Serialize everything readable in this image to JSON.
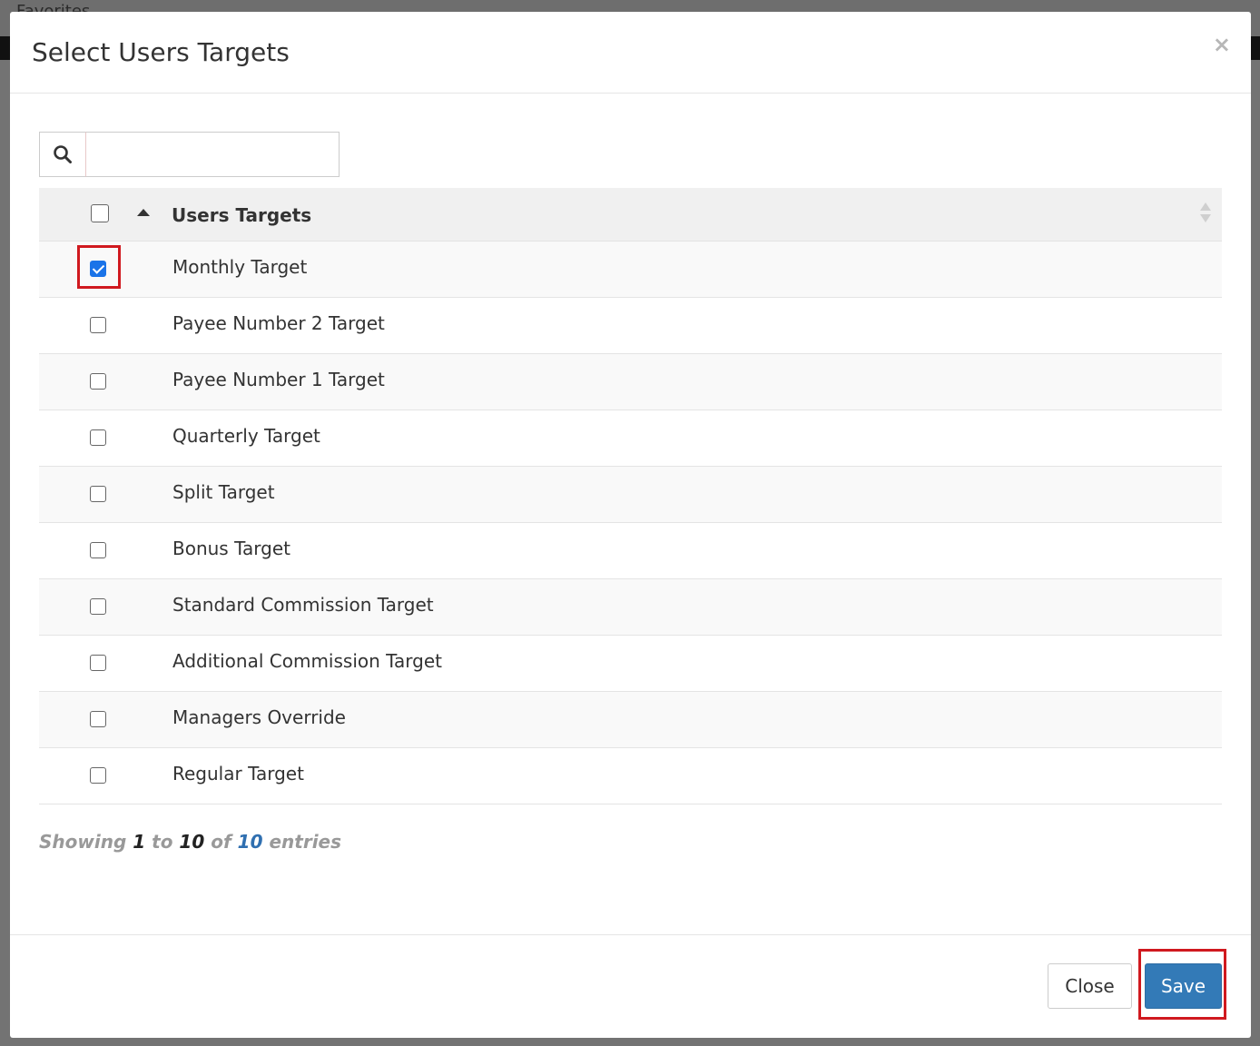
{
  "background": {
    "favorites_label": "Favorites"
  },
  "modal": {
    "title": "Select Users Targets",
    "close_glyph": "×",
    "search": {
      "value": "",
      "placeholder": ""
    },
    "table": {
      "header": "Users Targets",
      "rows": [
        {
          "label": "Monthly Target",
          "checked": true
        },
        {
          "label": "Payee Number 2 Target",
          "checked": false
        },
        {
          "label": "Payee Number 1 Target",
          "checked": false
        },
        {
          "label": "Quarterly Target",
          "checked": false
        },
        {
          "label": "Split Target",
          "checked": false
        },
        {
          "label": "Bonus Target",
          "checked": false
        },
        {
          "label": "Standard Commission Target",
          "checked": false
        },
        {
          "label": "Additional Commission Target",
          "checked": false
        },
        {
          "label": "Managers Override",
          "checked": false
        },
        {
          "label": "Regular Target",
          "checked": false
        }
      ]
    },
    "info": {
      "showing": "Showing",
      "from": "1",
      "to_word": "to",
      "to": "10",
      "of_word": "of",
      "total": "10",
      "entries_word": "entries"
    },
    "footer": {
      "close_label": "Close",
      "save_label": "Save"
    }
  },
  "colors": {
    "primary": "#337ab7",
    "highlight": "#d0191f",
    "checkbox_checked": "#1a73e8"
  }
}
